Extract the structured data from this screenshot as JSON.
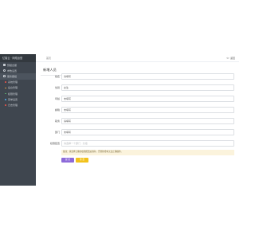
{
  "sidebar": {
    "title": "亿客云 · 网络运营",
    "items": [
      {
        "label": "预报合服",
        "icon": "cube-icon"
      },
      {
        "label": "参数设置",
        "icon": "cog-icon"
      },
      {
        "label": "服务器组",
        "icon": "users-icon",
        "active": true
      }
    ],
    "subitems": [
      {
        "label": "系统管理",
        "color": "#e0534a"
      },
      {
        "label": "后台管理",
        "color": "#f2a640"
      },
      {
        "label": "权限管理",
        "color": "#5bb26b"
      },
      {
        "label": "菜单设置",
        "color": "#4fa3e0"
      },
      {
        "label": "日志管理",
        "color": "#e0534a"
      }
    ]
  },
  "topbar": {
    "breadcrumb": "首页",
    "back_label": "返回"
  },
  "panel": {
    "title": "新增人员"
  },
  "form": {
    "fields": [
      {
        "label": "姓名",
        "value": "请填写",
        "placeholder": false
      },
      {
        "label": "性别",
        "value": "女生",
        "placeholder": false
      },
      {
        "label": "年龄",
        "value": "未填写",
        "placeholder": false
      },
      {
        "label": "邮箱",
        "value": "未填写",
        "placeholder": false
      },
      {
        "label": "职务",
        "value": "请填写",
        "placeholder": false
      },
      {
        "label": "部门",
        "value": "未填写",
        "placeholder": false
      },
      {
        "label": "权限配置",
        "value": "请选择一个部门 · 分组",
        "placeholder": true
      }
    ],
    "tip": "备注：请选择正确的权限配置后保存，否则新增将无法正确操作。",
    "submit_label": "提 交",
    "reset_label": "重 置"
  }
}
